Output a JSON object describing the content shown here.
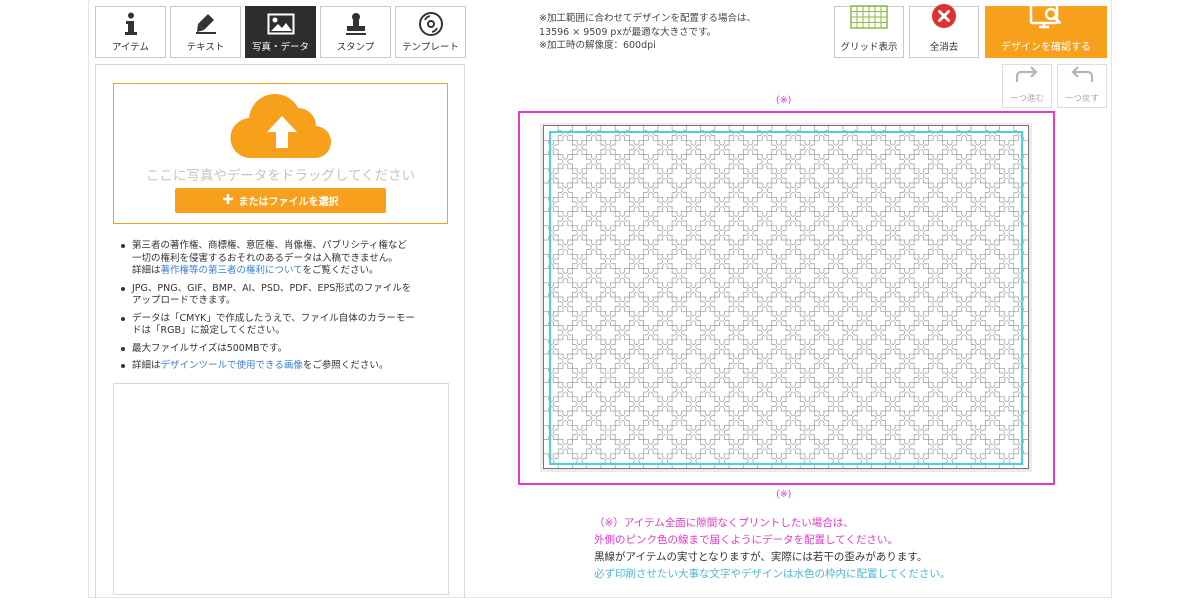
{
  "tabs": [
    {
      "label": "アイテム",
      "icon": "info-icon"
    },
    {
      "label": "テキスト",
      "icon": "pen-icon"
    },
    {
      "label": "写真・データ",
      "icon": "image-icon",
      "active": true
    },
    {
      "label": "スタンプ",
      "icon": "stamp-icon"
    },
    {
      "label": "テンプレート",
      "icon": "template-icon"
    }
  ],
  "notice": {
    "line1": "※加工範囲に合わせてデザインを配置する場合は、",
    "line2": "13596 × 9509 pxが最適な大きさです。",
    "line3": "※加工時の解像度：600dpi"
  },
  "toolbar": {
    "grid_label": "グリッド表示",
    "clear_label": "全消去",
    "confirm_label": "デザインを確認する",
    "redo_label": "一つ進む",
    "undo_label": "一つ戻す"
  },
  "upload": {
    "drag_text": "ここに写真やデータをドラッグしてください",
    "select_label": "またはファイルを選択"
  },
  "notes": {
    "n1_l1": "第三者の著作権、商標権、意匠権、肖像権、パブリシティ権など",
    "n1_l2": "一切の権利を侵害するおそれのあるデータは入稿できません。",
    "n1_l3_pre": "詳細は",
    "n1_l3_link": "著作権等の第三者の権利について",
    "n1_l3_post": "をご覧ください。",
    "n2_l1": "JPG、PNG、GIF、BMP、AI、PSD、PDF、EPS形式のファイルを",
    "n2_l2": "アップロードできます。",
    "n3_l1": "データは「CMYK」で作成したうえで、ファイル自体のカラーモー",
    "n3_l2": "ドは「RGB」に設定してください。",
    "n4": "最大ファイルサイズは500MBです。",
    "n5_pre": "詳細は",
    "n5_link": "デザインツールで使用できる画像",
    "n5_post": "をご参照ください。"
  },
  "canvas": {
    "mark_top": "(※)",
    "mark_bottom": "(※)"
  },
  "caption": {
    "line1": "（※）アイテム全面に隙間なくプリントしたい場合は、",
    "line2": "外側のピンク色の線まで届くようにデータを配置してください。",
    "line3": "黒線がアイテムの実寸となりますが、実際には若干の歪みがあります。",
    "line4": "必ず印刷させたい大事な文字やデザインは水色の枠内に配置してください。"
  },
  "colors": {
    "accent": "#f7a01c",
    "bleed_line": "#e03ccf",
    "safe_line": "#4ad3df",
    "link": "#3b7dd8",
    "active_tab": "#2d2d2d",
    "clear_icon": "#e03030",
    "grid_icon": "#8db84a"
  }
}
